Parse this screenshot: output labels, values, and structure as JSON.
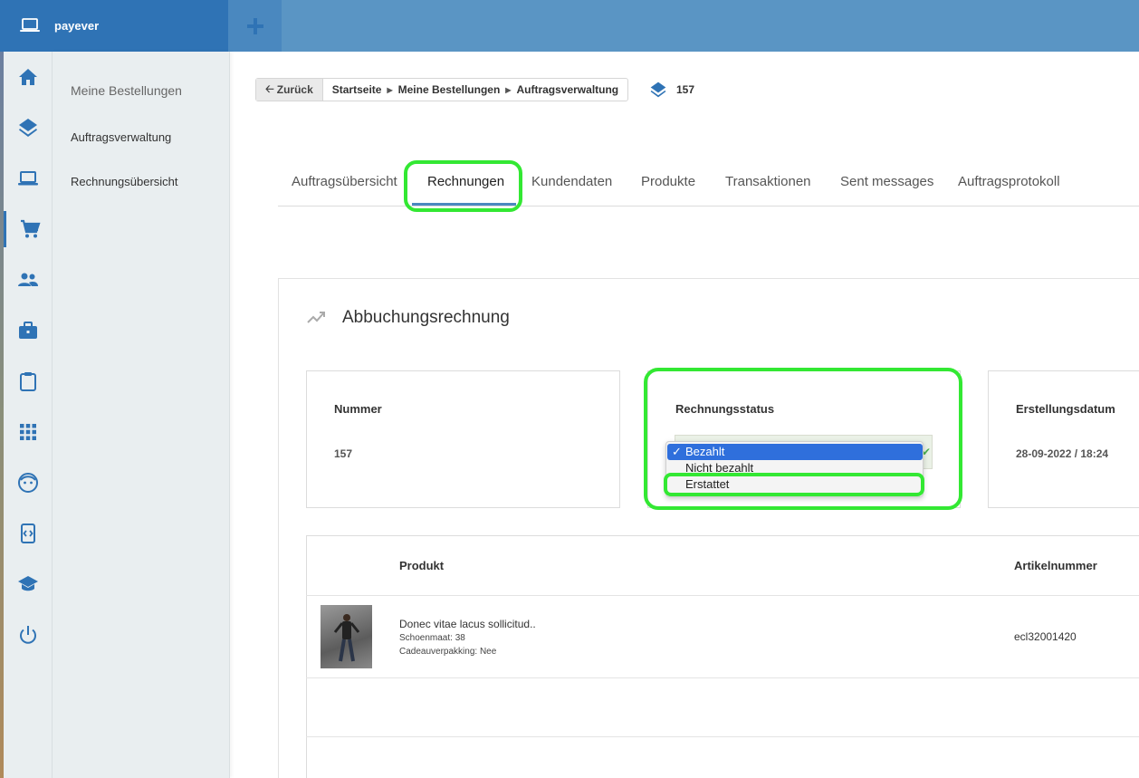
{
  "app": {
    "brand": "payever"
  },
  "subnav": {
    "items": [
      "Meine Bestellungen",
      "Auftragsverwaltung",
      "Rechnungsübersicht"
    ]
  },
  "breadcrumb": {
    "back": "Zurück",
    "items": [
      "Startseite",
      "Meine Bestellungen",
      "Auftragsverwaltung"
    ]
  },
  "order": {
    "number": "157"
  },
  "tabs": [
    "Auftragsübersicht",
    "Rechnungen",
    "Kundendaten",
    "Produkte",
    "Transaktionen",
    "Sent messages",
    "Auftragsprotokoll"
  ],
  "active_tab": "Rechnungen",
  "invoice": {
    "title": "Abbuchungsrechnung",
    "number_label": "Nummer",
    "number_value": "157",
    "status_label": "Rechnungsstatus",
    "status_options": [
      "Bezahlt",
      "Nicht bezahlt",
      "Erstattet"
    ],
    "status_selected": "Bezahlt",
    "date_label": "Erstellungsdatum",
    "date_value": "28-09-2022 / 18:24"
  },
  "products": {
    "headers": {
      "product": "Produkt",
      "sku": "Artikelnummer"
    },
    "rows": [
      {
        "name": "Donec vitae lacus sollicitud..",
        "meta1": "Schoenmaat: 38",
        "meta2": "Cadeauverpakking: Nee",
        "sku": "ecl32001420"
      }
    ]
  },
  "colors": {
    "brand": "#2f73b5",
    "topbar": "#5a95c4",
    "highlight": "#33e833",
    "select": "#2f6fdc"
  }
}
